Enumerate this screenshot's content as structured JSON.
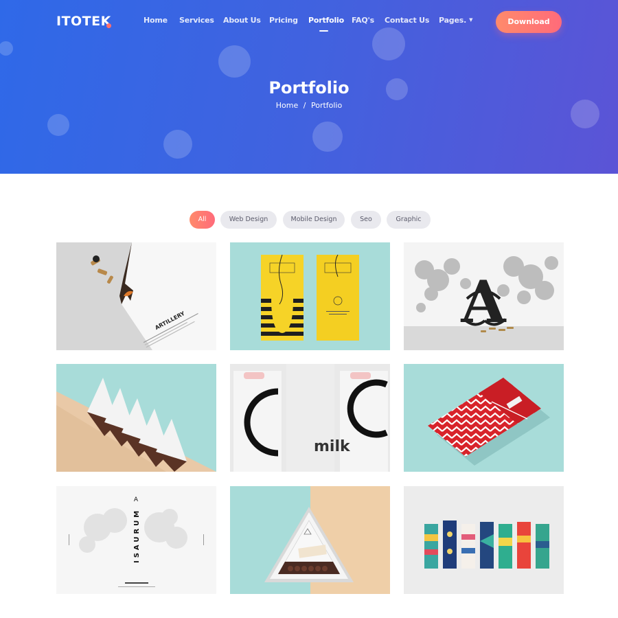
{
  "brand": {
    "name": "ITOTEK",
    "dot_color": "#ff6f6f"
  },
  "nav": {
    "items": [
      {
        "label": "Home"
      },
      {
        "label": "Services"
      },
      {
        "label": "About Us"
      },
      {
        "label": "Pricing"
      },
      {
        "label": "Portfolio",
        "active": true
      },
      {
        "label": "FAQ's"
      },
      {
        "label": "Contact Us"
      },
      {
        "label": "Pages."
      }
    ],
    "download_label": "Download"
  },
  "hero": {
    "title": "Portfolio",
    "breadcrumb": {
      "home": "Home",
      "separator": "/",
      "current": "Portfolio"
    }
  },
  "filters": [
    {
      "label": "All",
      "active": true
    },
    {
      "label": "Web Design"
    },
    {
      "label": "Mobile Design"
    },
    {
      "label": "Seo"
    },
    {
      "label": "Graphic"
    }
  ],
  "portfolio": {
    "items": [
      {
        "name": "artillery-letterhead",
        "text": "ARTILLERY"
      },
      {
        "name": "yellow-striped-packaging"
      },
      {
        "name": "artillery-monogram",
        "text": "A"
      },
      {
        "name": "triangle-chocolate-boxes"
      },
      {
        "name": "milk-bottles",
        "text": "milk"
      },
      {
        "name": "red-chevron-envelope"
      },
      {
        "name": "isaurum-poster",
        "text": "ISAURUM"
      },
      {
        "name": "triangle-chocolate-tray"
      },
      {
        "name": "patterned-tubes"
      }
    ]
  },
  "colors": {
    "accent": "#ff7a72",
    "hero_gradient_start": "#2f69e8",
    "hero_gradient_end": "#5b54d6",
    "mint": "#a8dcd9"
  }
}
